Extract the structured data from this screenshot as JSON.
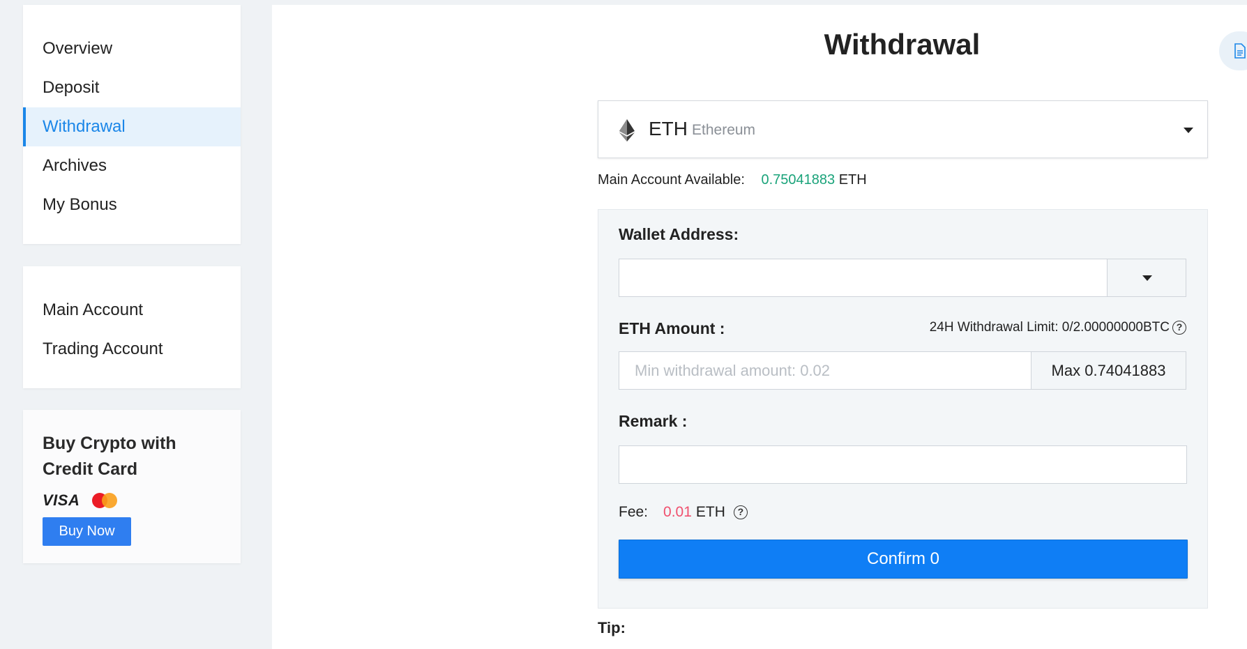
{
  "sidebar": {
    "nav": [
      {
        "label": "Overview",
        "active": false
      },
      {
        "label": "Deposit",
        "active": false
      },
      {
        "label": "Withdrawal",
        "active": true
      },
      {
        "label": "Archives",
        "active": false
      },
      {
        "label": "My Bonus",
        "active": false
      }
    ],
    "accounts": [
      {
        "label": "Main Account"
      },
      {
        "label": "Trading Account"
      }
    ],
    "buy_card": {
      "title": "Buy Crypto with Credit Card",
      "visa_text": "VISA",
      "button_label": "Buy Now"
    }
  },
  "main": {
    "title": "Withdrawal",
    "coin": {
      "symbol": "ETH",
      "name": "Ethereum",
      "icon": "ethereum-icon"
    },
    "available": {
      "label": "Main Account Available:",
      "value": "0.75041883",
      "unit": "ETH"
    },
    "form": {
      "wallet_label": "Wallet Address:",
      "wallet_value": "",
      "amount_label": "ETH Amount :",
      "limit_text": "24H Withdrawal Limit: 0/2.00000000BTC",
      "amount_placeholder": "Min withdrawal amount:  0.02",
      "max_label": "Max 0.74041883",
      "remark_label": "Remark :",
      "remark_value": "",
      "fee_label": "Fee:",
      "fee_value": "0.01",
      "fee_unit": "ETH",
      "help_glyph": "?",
      "confirm_label": "Confirm 0"
    },
    "tip_label": "Tip:"
  },
  "colors": {
    "accent": "#1a86e8",
    "confirm": "#0f7ef5",
    "available_value": "#1aa37a",
    "fee_value": "#f0506e"
  }
}
